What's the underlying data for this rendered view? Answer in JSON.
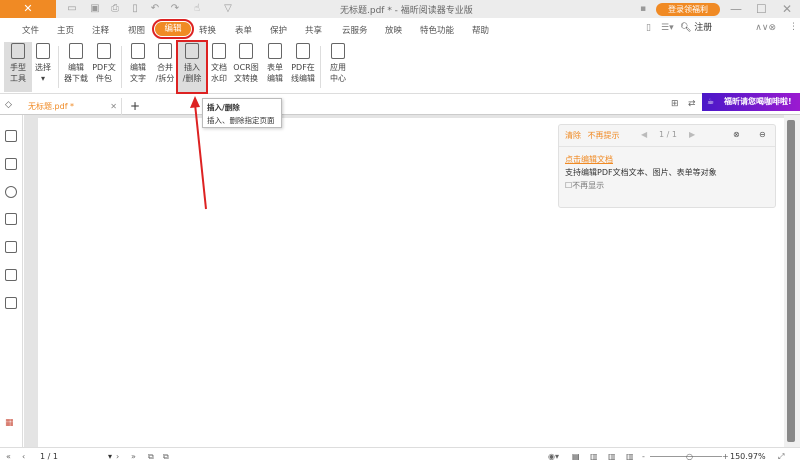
{
  "titlebar": {
    "title": "无标题.pdf * - 福昕阅读器专业版",
    "login": "登录领福利"
  },
  "menu": [
    "文件",
    "主页",
    "注释",
    "视图",
    "编辑",
    "转换",
    "表单",
    "保护",
    "共享",
    "云服务",
    "放映",
    "特色功能",
    "帮助"
  ],
  "search": {
    "value": "注册"
  },
  "ribbon": [
    {
      "label": "手型\n工具"
    },
    {
      "label": "选择"
    },
    {
      "label": "编辑\n器下载"
    },
    {
      "label": "PDF文\n件包"
    },
    {
      "label": "编辑\n文字"
    },
    {
      "label": "合并\n/拆分"
    },
    {
      "label": "插入\n/删除"
    },
    {
      "label": "文档\n水印"
    },
    {
      "label": "OCR图\n文转换"
    },
    {
      "label": "表单\n编辑"
    },
    {
      "label": "PDF在\n线编辑"
    },
    {
      "label": "应用\n中心"
    }
  ],
  "tab": {
    "name": "无标题.pdf *",
    "add": "+"
  },
  "tooltip": {
    "title": "插入/删除",
    "desc": "插入、删除指定页面"
  },
  "promo": "福昕请您喝咖啡啦!",
  "panel": {
    "clear": "清除",
    "nomore": "不再提示",
    "page": "1 / 1",
    "link": "点击编辑文档",
    "desc": "支持编辑PDF文档文本、图片、表单等对象",
    "checkbox": "不再显示"
  },
  "status": {
    "page": "1 / 1",
    "zoom": "150.97%"
  },
  "colors": {
    "accent": "#f08a24",
    "highlight": "#dd2222"
  }
}
